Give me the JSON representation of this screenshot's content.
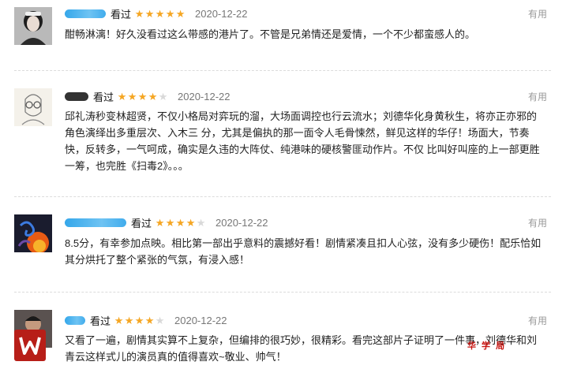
{
  "reviews": [
    {
      "watched_label": "看过",
      "rating": 5,
      "date": "2020-12-22",
      "useful_label": "有用",
      "text": "酣畅淋漓！好久没看过这么带感的港片了。不管是兄弟情还是爱情，一个不少都蛮感人的。",
      "avatar": "woman-portrait"
    },
    {
      "watched_label": "看过",
      "rating": 4,
      "date": "2020-12-22",
      "useful_label": "有用",
      "text": "邱礼涛秒变林超贤，不仅小格局对弈玩的溜，大场面调控也行云流水；刘德华化身黄秋生，将亦正亦邪的角色演绎出多重层次、入木三 分，尤其是偏执的那一面令人毛骨悚然，鲜见这样的华仔！场面大，节奏快，反转多，一气呵成，确实是久违的大阵仗、纯港味的硬核警匪动作片。不仅 比叫好叫座的上一部更胜一筹，也完胜《扫毒2》。。。",
      "avatar": "sketch-glasses"
    },
    {
      "watched_label": "看过",
      "rating": 4,
      "date": "2020-12-22",
      "useful_label": "有用",
      "text": "8.5分，有幸参加点映。相比第一部出乎意料的震撼好看！剧情紧凑且扣人心弦，没有多少硬伤！配乐恰如其分烘托了整个紧张的气氛，有浸入感！",
      "avatar": "dragon-fire"
    },
    {
      "watched_label": "看过",
      "rating": 4,
      "date": "2020-12-22",
      "useful_label": "有用",
      "text": "又看了一遍，剧情其实算不上复杂，但编排的很巧妙，很精彩。看完这部片子证明了一件事，刘德华和刘青云这样式儿的演员真的值得喜欢~敬业、帅气！",
      "avatar": "person-photo"
    }
  ],
  "watermark": {
    "text": "华 学 局"
  },
  "colors": {
    "star_on": "#f5a623",
    "star_off": "#d9d9d9",
    "muted": "#999999"
  }
}
